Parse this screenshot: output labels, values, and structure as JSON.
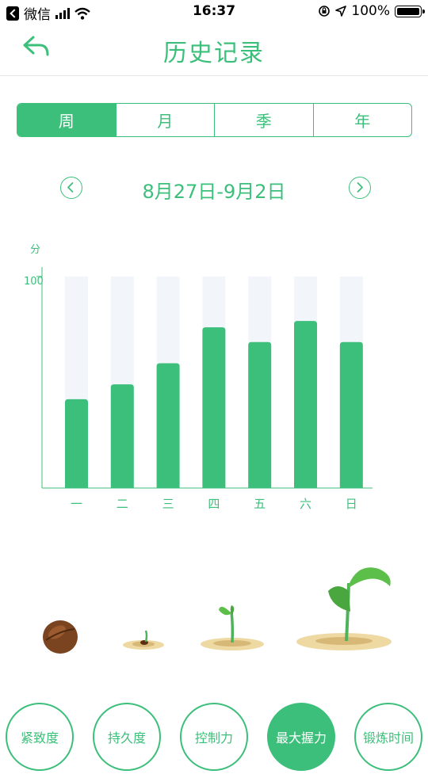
{
  "status_bar": {
    "carrier": "微信",
    "time": "16:37",
    "battery": "100%"
  },
  "header": {
    "title": "历史记录"
  },
  "period_tabs": [
    {
      "label": "周",
      "active": true
    },
    {
      "label": "月",
      "active": false
    },
    {
      "label": "季",
      "active": false
    },
    {
      "label": "年",
      "active": false
    }
  ],
  "date_range": {
    "label": "8月27日-9月2日"
  },
  "colors": {
    "accent": "#3cbf7a",
    "bar_track": "#f2f6fb"
  },
  "chart_data": {
    "type": "bar",
    "categories": [
      "一",
      "二",
      "三",
      "四",
      "五",
      "六",
      "日"
    ],
    "values": [
      42,
      49,
      59,
      76,
      69,
      79,
      69
    ],
    "ylabel": "分",
    "ylim": [
      0,
      100
    ],
    "yticks": [
      "100"
    ],
    "grid": false
  },
  "metrics": [
    {
      "label": "紧致度",
      "active": false
    },
    {
      "label": "持久度",
      "active": false
    },
    {
      "label": "控制力",
      "active": false
    },
    {
      "label": "最大握力",
      "active": true
    },
    {
      "label": "锻炼时间",
      "active": false
    }
  ]
}
